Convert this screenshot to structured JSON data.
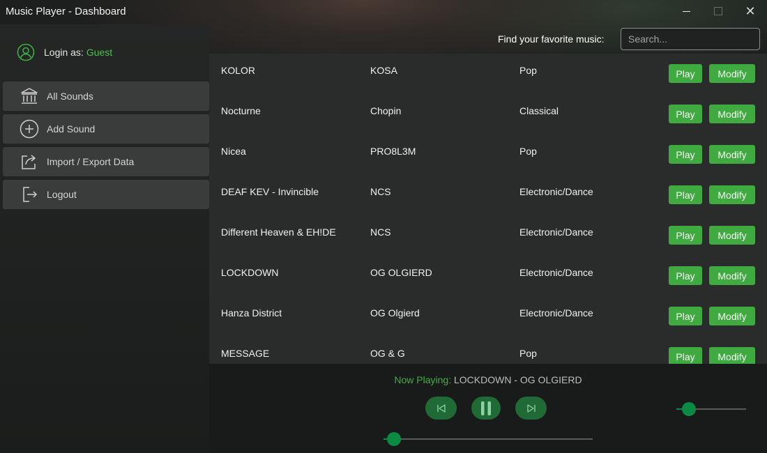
{
  "window": {
    "title": "Music Player - Dashboard"
  },
  "login": {
    "prefix": "Login as:",
    "user": "Guest"
  },
  "sidebar": {
    "items": [
      {
        "label": "All Sounds",
        "icon": "library-icon"
      },
      {
        "label": "Add Sound",
        "icon": "add-circle-icon"
      },
      {
        "label": "Import / Export Data",
        "icon": "share-export-icon"
      },
      {
        "label": "Logout",
        "icon": "logout-icon"
      }
    ]
  },
  "search": {
    "label": "Find your favorite music:",
    "placeholder": "Search...",
    "value": ""
  },
  "songs": [
    {
      "title": "KOLOR",
      "artist": "KOSA",
      "genre": "Pop"
    },
    {
      "title": "Nocturne",
      "artist": "Chopin",
      "genre": "Classical"
    },
    {
      "title": "Nicea",
      "artist": "PRO8L3M",
      "genre": "Pop"
    },
    {
      "title": "DEAF KEV - Invincible",
      "artist": "NCS",
      "genre": "Electronic/Dance"
    },
    {
      "title": "Different Heaven & EH!DE",
      "artist": "NCS",
      "genre": "Electronic/Dance"
    },
    {
      "title": "LOCKDOWN",
      "artist": "OG OLGIERD",
      "genre": "Electronic/Dance"
    },
    {
      "title": "Hanza District",
      "artist": "OG Olgierd",
      "genre": "Electronic/Dance"
    },
    {
      "title": "MESSAGE",
      "artist": "OG & G",
      "genre": "Pop"
    }
  ],
  "buttons": {
    "play": "Play",
    "modify": "Modify"
  },
  "player": {
    "now_playing_label": "Now Playing:",
    "now_playing_track": "LOCKDOWN - OG OLGIERD",
    "volume": 0.18,
    "progress": 0.05
  },
  "colors": {
    "accent": "#3faa3f",
    "guest": "#4ec04e",
    "control": "#1f6a35",
    "knob": "#0b8a43"
  }
}
